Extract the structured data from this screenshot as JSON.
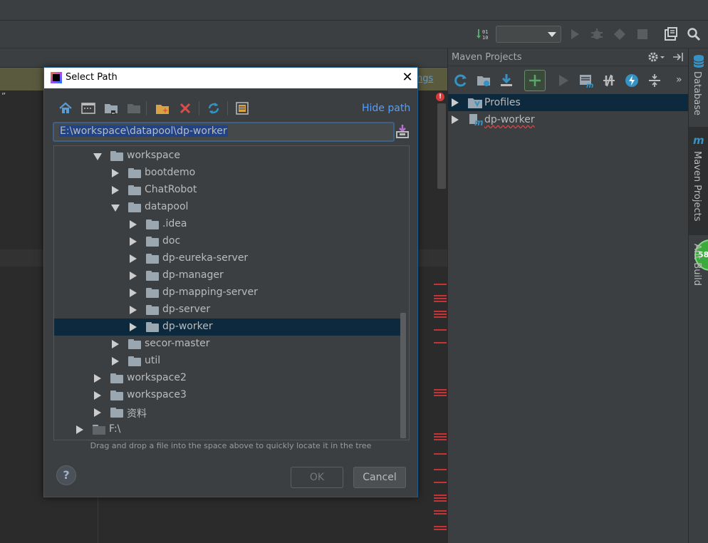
{
  "ide": {
    "notice_link": "ngs",
    "editor_quote": "”",
    "error_mark": "!"
  },
  "maven": {
    "title": "Maven Projects",
    "tree": [
      {
        "label": "Profiles",
        "selected": true
      },
      {
        "label": "dp-worker",
        "selected": false
      }
    ],
    "more": "»"
  },
  "stripe": {
    "database": "Database",
    "maven_projects": "Maven Projects",
    "ant_build": "Ant Build",
    "maven_glyph": "m",
    "badge": "58"
  },
  "dialog": {
    "title": "Select Path",
    "close": "✕",
    "hide_path": "Hide path",
    "path_value": "E:\\workspace\\datapool\\dp-worker",
    "tree": [
      {
        "label": "workspace",
        "level": 1,
        "expanded": true
      },
      {
        "label": "bootdemo",
        "level": 2,
        "expanded": false
      },
      {
        "label": "ChatRobot",
        "level": 2,
        "expanded": false
      },
      {
        "label": "datapool",
        "level": 2,
        "expanded": true
      },
      {
        "label": ".idea",
        "level": 3,
        "expanded": false
      },
      {
        "label": "doc",
        "level": 3,
        "expanded": false
      },
      {
        "label": "dp-eureka-server",
        "level": 3,
        "expanded": false
      },
      {
        "label": "dp-manager",
        "level": 3,
        "expanded": false
      },
      {
        "label": "dp-mapping-server",
        "level": 3,
        "expanded": false
      },
      {
        "label": "dp-server",
        "level": 3,
        "expanded": false
      },
      {
        "label": "dp-worker",
        "level": 3,
        "expanded": false,
        "selected": true
      },
      {
        "label": "secor-master",
        "level": 2,
        "expanded": false
      },
      {
        "label": "util",
        "level": 2,
        "expanded": false
      },
      {
        "label": "workspace2",
        "level": 1,
        "expanded": false
      },
      {
        "label": "workspace3",
        "level": 1,
        "expanded": false
      },
      {
        "label": "资料",
        "level": 1,
        "expanded": false
      },
      {
        "label": "F:\\",
        "level": 0,
        "expanded": false,
        "drive": true
      }
    ],
    "hint": "Drag and drop a file into the space above to quickly locate it in the tree",
    "help": "?",
    "ok_label": "OK",
    "cancel_label": "Cancel"
  }
}
